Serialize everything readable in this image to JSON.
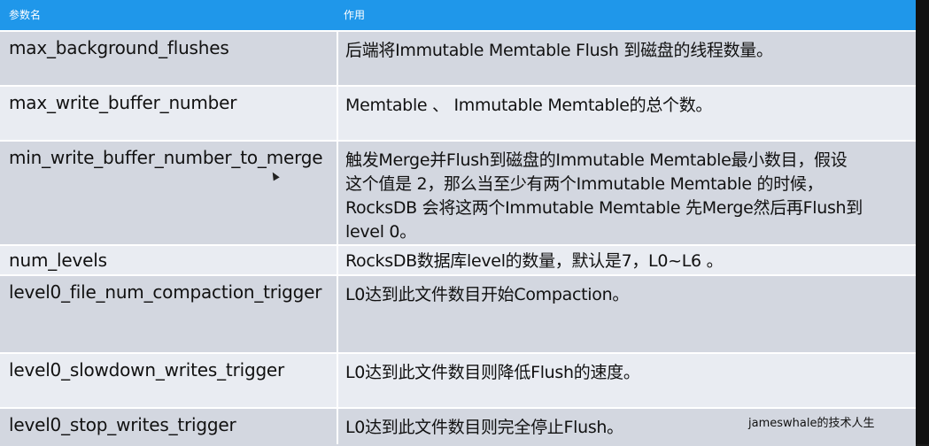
{
  "table": {
    "header": {
      "col1": "参数名",
      "col2": "作用"
    },
    "rows": [
      {
        "name": "max_background_flushes",
        "desc": [
          "后端将Immutable Memtable Flush 到磁盘的线程数量。"
        ]
      },
      {
        "name": "max_write_buffer_number",
        "desc": [
          "Memtable 、 Immutable Memtable的总个数。"
        ]
      },
      {
        "name": "min_write_buffer_number_to_merge",
        "desc": [
          "触发Merge并Flush到磁盘的Immutable Memtable最小数目，假设",
          "这个值是 2，那么当至少有两个Immutable Memtable 的时候，",
          "RocksDB 会将这两个Immutable Memtable 先Merge然后再Flush到",
          "level 0。"
        ]
      },
      {
        "name": "num_levels",
        "desc": [
          "RocksDB数据库level的数量，默认是7，L0~L6 。"
        ]
      },
      {
        "name": "level0_file_num_compaction_trigger",
        "desc": [
          "L0达到此文件数目开始Compaction。"
        ]
      },
      {
        "name": "level0_slowdown_writes_trigger",
        "desc": [
          "L0达到此文件数目则降低Flush的速度。"
        ]
      },
      {
        "name": "level0_stop_writes_trigger",
        "desc": [
          "L0达到此文件数目则完全停止Flush。"
        ]
      }
    ]
  },
  "watermark": "jameswhale的技术人生",
  "colors": {
    "header": "#1f97ea",
    "row_dark": "#d3d7e0",
    "row_light": "#e9ecf2"
  }
}
